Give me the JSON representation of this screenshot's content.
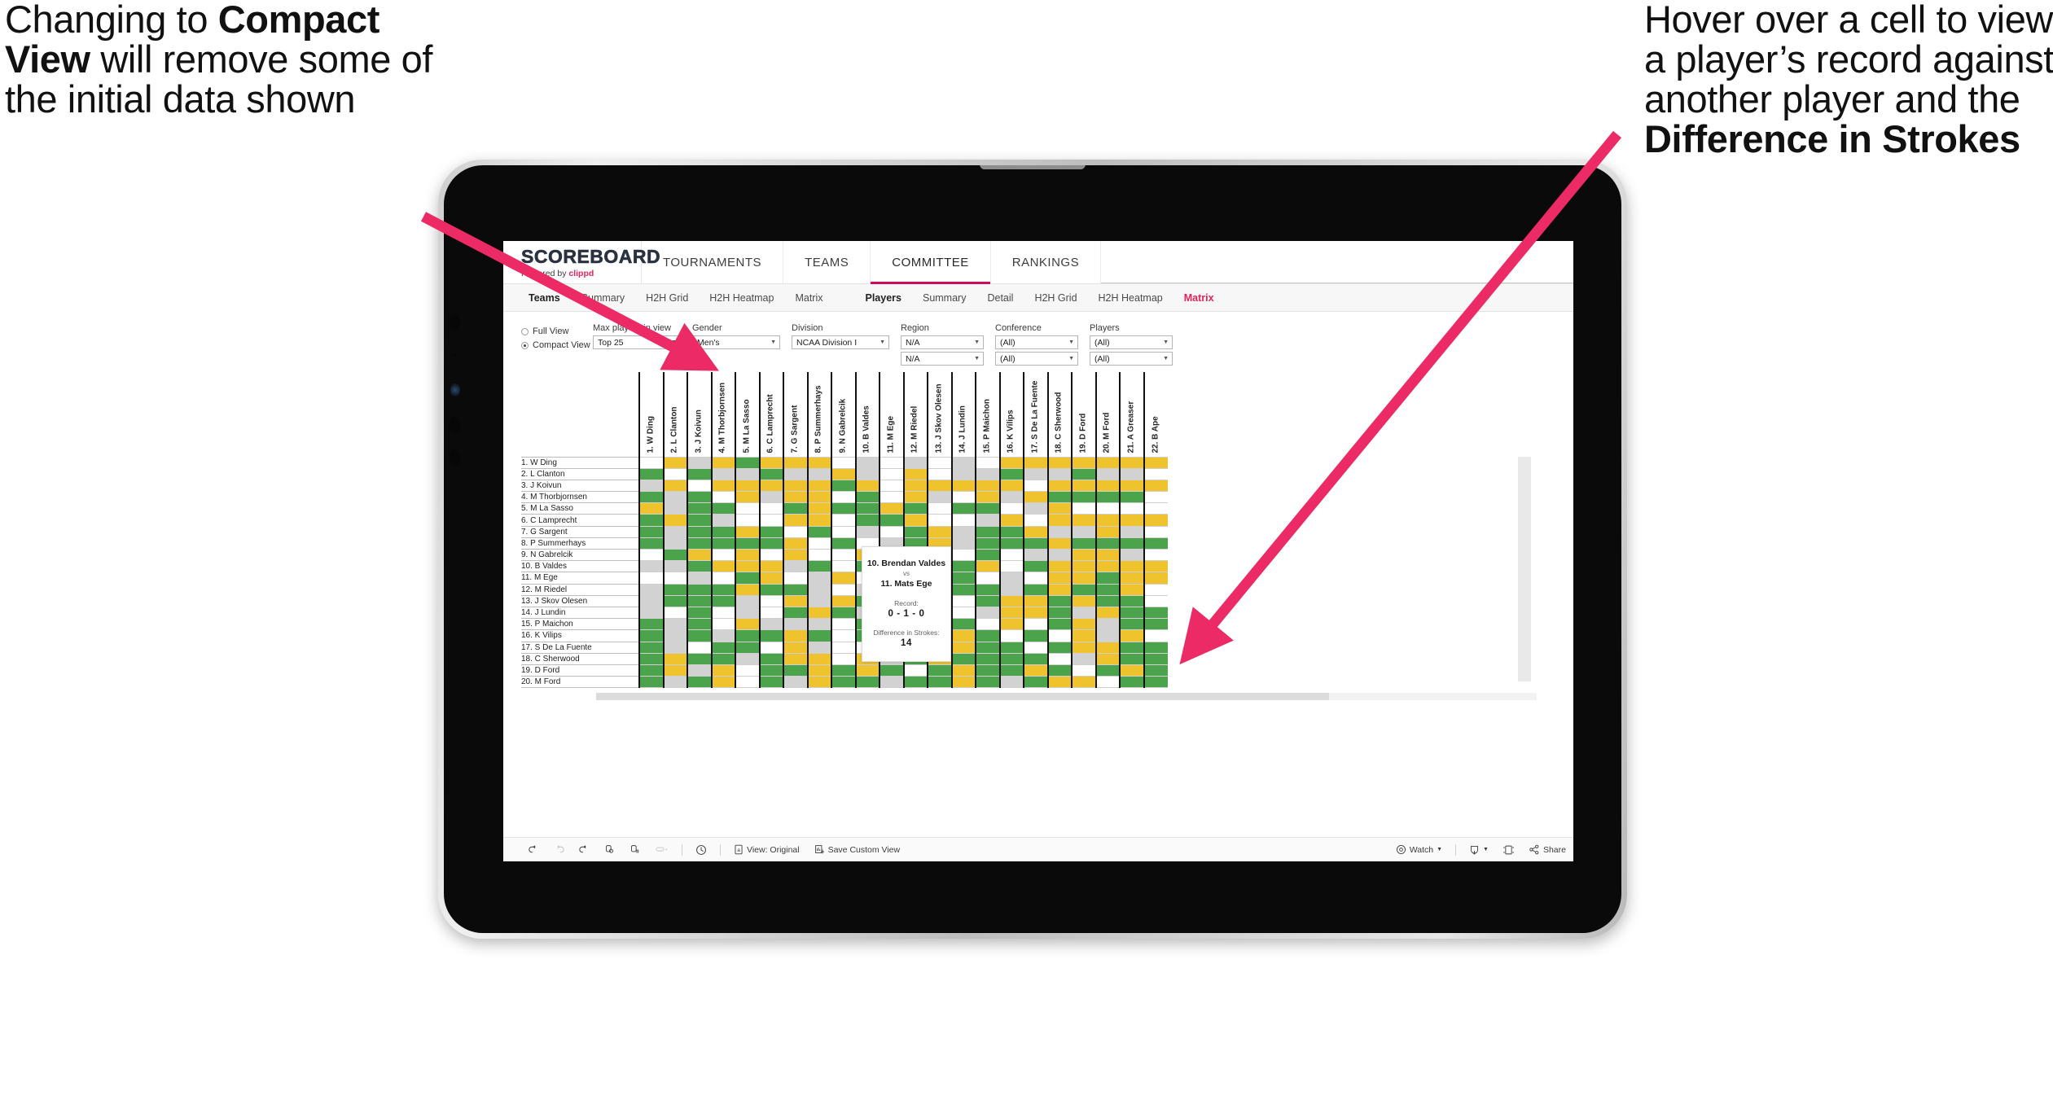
{
  "annotations": {
    "left": {
      "pre": "Changing to ",
      "bold": "Compact View",
      "post": " will remove some of the initial data shown"
    },
    "right": {
      "pre": "Hover over a cell to view a player’s record against another player and the ",
      "bold": "Difference in Strokes",
      "post": ""
    },
    "arrow_color": "#ec2a66"
  },
  "app": {
    "brand": {
      "wordmark": "SCOREBOARD",
      "powered_prefix": "Powered by ",
      "powered_brand": "clippd"
    },
    "top_tabs": [
      {
        "label": "TOURNAMENTS",
        "active": false
      },
      {
        "label": "TEAMS",
        "active": false
      },
      {
        "label": "COMMITTEE",
        "active": true
      },
      {
        "label": "RANKINGS",
        "active": false
      }
    ],
    "sub_tabs_left": [
      {
        "label": "Teams",
        "style": "bold"
      },
      {
        "label": "Summary",
        "style": "normal"
      },
      {
        "label": "H2H Grid",
        "style": "normal"
      },
      {
        "label": "H2H Heatmap",
        "style": "normal"
      },
      {
        "label": "Matrix",
        "style": "normal"
      }
    ],
    "sub_tabs_right": [
      {
        "label": "Players",
        "style": "bold"
      },
      {
        "label": "Summary",
        "style": "normal"
      },
      {
        "label": "Detail",
        "style": "normal"
      },
      {
        "label": "H2H Grid",
        "style": "normal"
      },
      {
        "label": "H2H Heatmap",
        "style": "normal"
      },
      {
        "label": "Matrix",
        "style": "pink"
      }
    ],
    "accent_color": "#cf0a5b"
  },
  "filters": {
    "view_mode": {
      "full_label": "Full View",
      "compact_label": "Compact View",
      "selected": "Compact View"
    },
    "fields": [
      {
        "label": "Max players in view",
        "value": "Top 25",
        "second": null
      },
      {
        "label": "Gender",
        "value": "Men's",
        "second": null
      },
      {
        "label": "Division",
        "value": "NCAA Division I",
        "second": null
      },
      {
        "label": "Region",
        "value": "N/A",
        "second": "N/A"
      },
      {
        "label": "Conference",
        "value": "(All)",
        "second": "(All)"
      },
      {
        "label": "Players",
        "value": "(All)",
        "second": "(All)"
      }
    ]
  },
  "matrix": {
    "row_labels": [
      "1. W Ding",
      "2. L Clanton",
      "3. J Koivun",
      "4. M Thorbjornsen",
      "5. M La Sasso",
      "6. C Lamprecht",
      "7. G Sargent",
      "8. P Summerhays",
      "9. N Gabrelcik",
      "10. B Valdes",
      "11. M Ege",
      "12. M Riedel",
      "13. J Skov Olesen",
      "14. J Lundin",
      "15. P Maichon",
      "16. K Vilips",
      "17. S De La Fuente",
      "18. C Sherwood",
      "19. D Ford",
      "20. M Ford"
    ],
    "column_labels": [
      "1. W Ding",
      "2. L Clanton",
      "3. J Koivun",
      "4. M Thorbjornsen",
      "5. M La Sasso",
      "6. C Lamprecht",
      "7. G Sargent",
      "8. P Summerhays",
      "9. N Gabrelcik",
      "10. B Valdes",
      "11. M Ege",
      "12. M Riedel",
      "13. J Skov Olesen",
      "14. J Lundin",
      "15. P Maichon",
      "16. K Vilips",
      "17. S De La Fuente",
      "18. C Sherwood",
      "19. D Ford",
      "20. M Ford",
      "21. A Greaser",
      "22. B Ape"
    ],
    "legend_colors": {
      "win": "#4ba34b",
      "loss": "#eec32e",
      "tie": "#d2d2d2",
      "none": "#ffffff"
    },
    "cells": [
      [
        "w",
        "y",
        "s",
        "y",
        "g",
        "y",
        "y",
        "y",
        "w",
        "s",
        "w",
        "s",
        "w",
        "s",
        "w",
        "y",
        "y",
        "y",
        "y",
        "y",
        "y",
        "y"
      ],
      [
        "g",
        "w",
        "g",
        "s",
        "s",
        "g",
        "s",
        "s",
        "y",
        "s",
        "w",
        "y",
        "w",
        "s",
        "s",
        "g",
        "s",
        "s",
        "g",
        "s",
        "s",
        "w"
      ],
      [
        "s",
        "y",
        "w",
        "y",
        "y",
        "y",
        "y",
        "y",
        "g",
        "y",
        "w",
        "y",
        "y",
        "y",
        "y",
        "y",
        "w",
        "y",
        "y",
        "y",
        "y",
        "y"
      ],
      [
        "g",
        "s",
        "g",
        "w",
        "y",
        "s",
        "y",
        "y",
        "w",
        "g",
        "w",
        "y",
        "s",
        "w",
        "y",
        "s",
        "y",
        "g",
        "g",
        "g",
        "g",
        "w"
      ],
      [
        "y",
        "s",
        "g",
        "g",
        "w",
        "w",
        "g",
        "y",
        "g",
        "g",
        "y",
        "g",
        "w",
        "g",
        "g",
        "w",
        "s",
        "y",
        "w",
        "w",
        "w",
        "w"
      ],
      [
        "g",
        "y",
        "g",
        "s",
        "w",
        "w",
        "y",
        "y",
        "w",
        "g",
        "g",
        "y",
        "w",
        "w",
        "s",
        "y",
        "w",
        "y",
        "y",
        "y",
        "y",
        "y"
      ],
      [
        "g",
        "s",
        "g",
        "g",
        "y",
        "g",
        "w",
        "g",
        "w",
        "s",
        "w",
        "g",
        "y",
        "s",
        "g",
        "g",
        "y",
        "s",
        "s",
        "y",
        "s",
        "w"
      ],
      [
        "g",
        "s",
        "g",
        "g",
        "g",
        "g",
        "y",
        "w",
        "g",
        "w",
        "s",
        "g",
        "y",
        "s",
        "g",
        "g",
        "g",
        "y",
        "g",
        "g",
        "g",
        "g"
      ],
      [
        "w",
        "g",
        "y",
        "w",
        "y",
        "w",
        "y",
        "w",
        "w",
        "y",
        "w",
        "s",
        "y",
        "w",
        "g",
        "w",
        "s",
        "s",
        "y",
        "y",
        "s",
        "w"
      ],
      [
        "s",
        "s",
        "g",
        "y",
        "y",
        "y",
        "s",
        "g",
        "w",
        "g",
        "y",
        "y",
        "w",
        "g",
        "y",
        "w",
        "g",
        "y",
        "y",
        "y",
        "y",
        "y"
      ],
      [
        "w",
        "w",
        "s",
        "w",
        "g",
        "y",
        "w",
        "s",
        "y",
        "w",
        "w",
        "s",
        "g",
        "g",
        "w",
        "s",
        "w",
        "y",
        "y",
        "g",
        "y",
        "y"
      ],
      [
        "s",
        "g",
        "g",
        "g",
        "y",
        "g",
        "g",
        "s",
        "w",
        "s",
        "g",
        "w",
        "s",
        "g",
        "g",
        "s",
        "g",
        "y",
        "g",
        "g",
        "y",
        "w"
      ],
      [
        "s",
        "g",
        "g",
        "g",
        "s",
        "w",
        "y",
        "s",
        "y",
        "g",
        "y",
        "s",
        "w",
        "w",
        "g",
        "y",
        "y",
        "g",
        "y",
        "g",
        "g",
        "w"
      ],
      [
        "s",
        "w",
        "g",
        "w",
        "s",
        "w",
        "g",
        "y",
        "g",
        "s",
        "w",
        "g",
        "s",
        "w",
        "s",
        "y",
        "y",
        "g",
        "s",
        "y",
        "g",
        "g"
      ],
      [
        "g",
        "s",
        "g",
        "w",
        "y",
        "s",
        "s",
        "s",
        "w",
        "g",
        "y",
        "g",
        "y",
        "g",
        "w",
        "y",
        "w",
        "g",
        "y",
        "s",
        "g",
        "g"
      ],
      [
        "g",
        "s",
        "g",
        "s",
        "g",
        "g",
        "y",
        "g",
        "w",
        "g",
        "g",
        "g",
        "s",
        "y",
        "g",
        "w",
        "g",
        "w",
        "y",
        "s",
        "y",
        "w"
      ],
      [
        "g",
        "s",
        "w",
        "g",
        "g",
        "w",
        "y",
        "s",
        "w",
        "w",
        "g",
        "g",
        "g",
        "y",
        "g",
        "g",
        "w",
        "g",
        "y",
        "y",
        "g",
        "g"
      ],
      [
        "g",
        "y",
        "g",
        "g",
        "s",
        "g",
        "y",
        "y",
        "w",
        "y",
        "s",
        "g",
        "y",
        "g",
        "g",
        "g",
        "g",
        "w",
        "s",
        "y",
        "g",
        "g"
      ],
      [
        "g",
        "y",
        "s",
        "y",
        "w",
        "g",
        "g",
        "y",
        "g",
        "y",
        "g",
        "w",
        "g",
        "y",
        "g",
        "g",
        "y",
        "g",
        "w",
        "g",
        "y",
        "g"
      ],
      [
        "g",
        "s",
        "g",
        "y",
        "w",
        "g",
        "s",
        "y",
        "g",
        "g",
        "s",
        "g",
        "g",
        "y",
        "g",
        "s",
        "g",
        "y",
        "y",
        "w",
        "g",
        "g"
      ]
    ]
  },
  "tooltip": {
    "player_a": "10. Brendan Valdes",
    "vs": "vs",
    "player_b": "11. Mats Ege",
    "record_label": "Record:",
    "record_value": "0 - 1 - 0",
    "diff_label": "Difference in Strokes:",
    "diff_value": "14"
  },
  "toolbar": {
    "items": [
      {
        "name": "undo-icon",
        "label": ""
      },
      {
        "name": "redo-icon",
        "label": ""
      },
      {
        "name": "revert-icon",
        "label": ""
      },
      {
        "name": "refresh-data-icon",
        "label": ""
      },
      {
        "name": "pause-refresh-icon",
        "label": ""
      },
      {
        "name": "highlight-icon",
        "label": ""
      },
      {
        "name": "clock-icon",
        "label": ""
      }
    ],
    "view_original": "View: Original",
    "save_custom_view": "Save Custom View",
    "watch": "Watch",
    "share": "Share"
  }
}
